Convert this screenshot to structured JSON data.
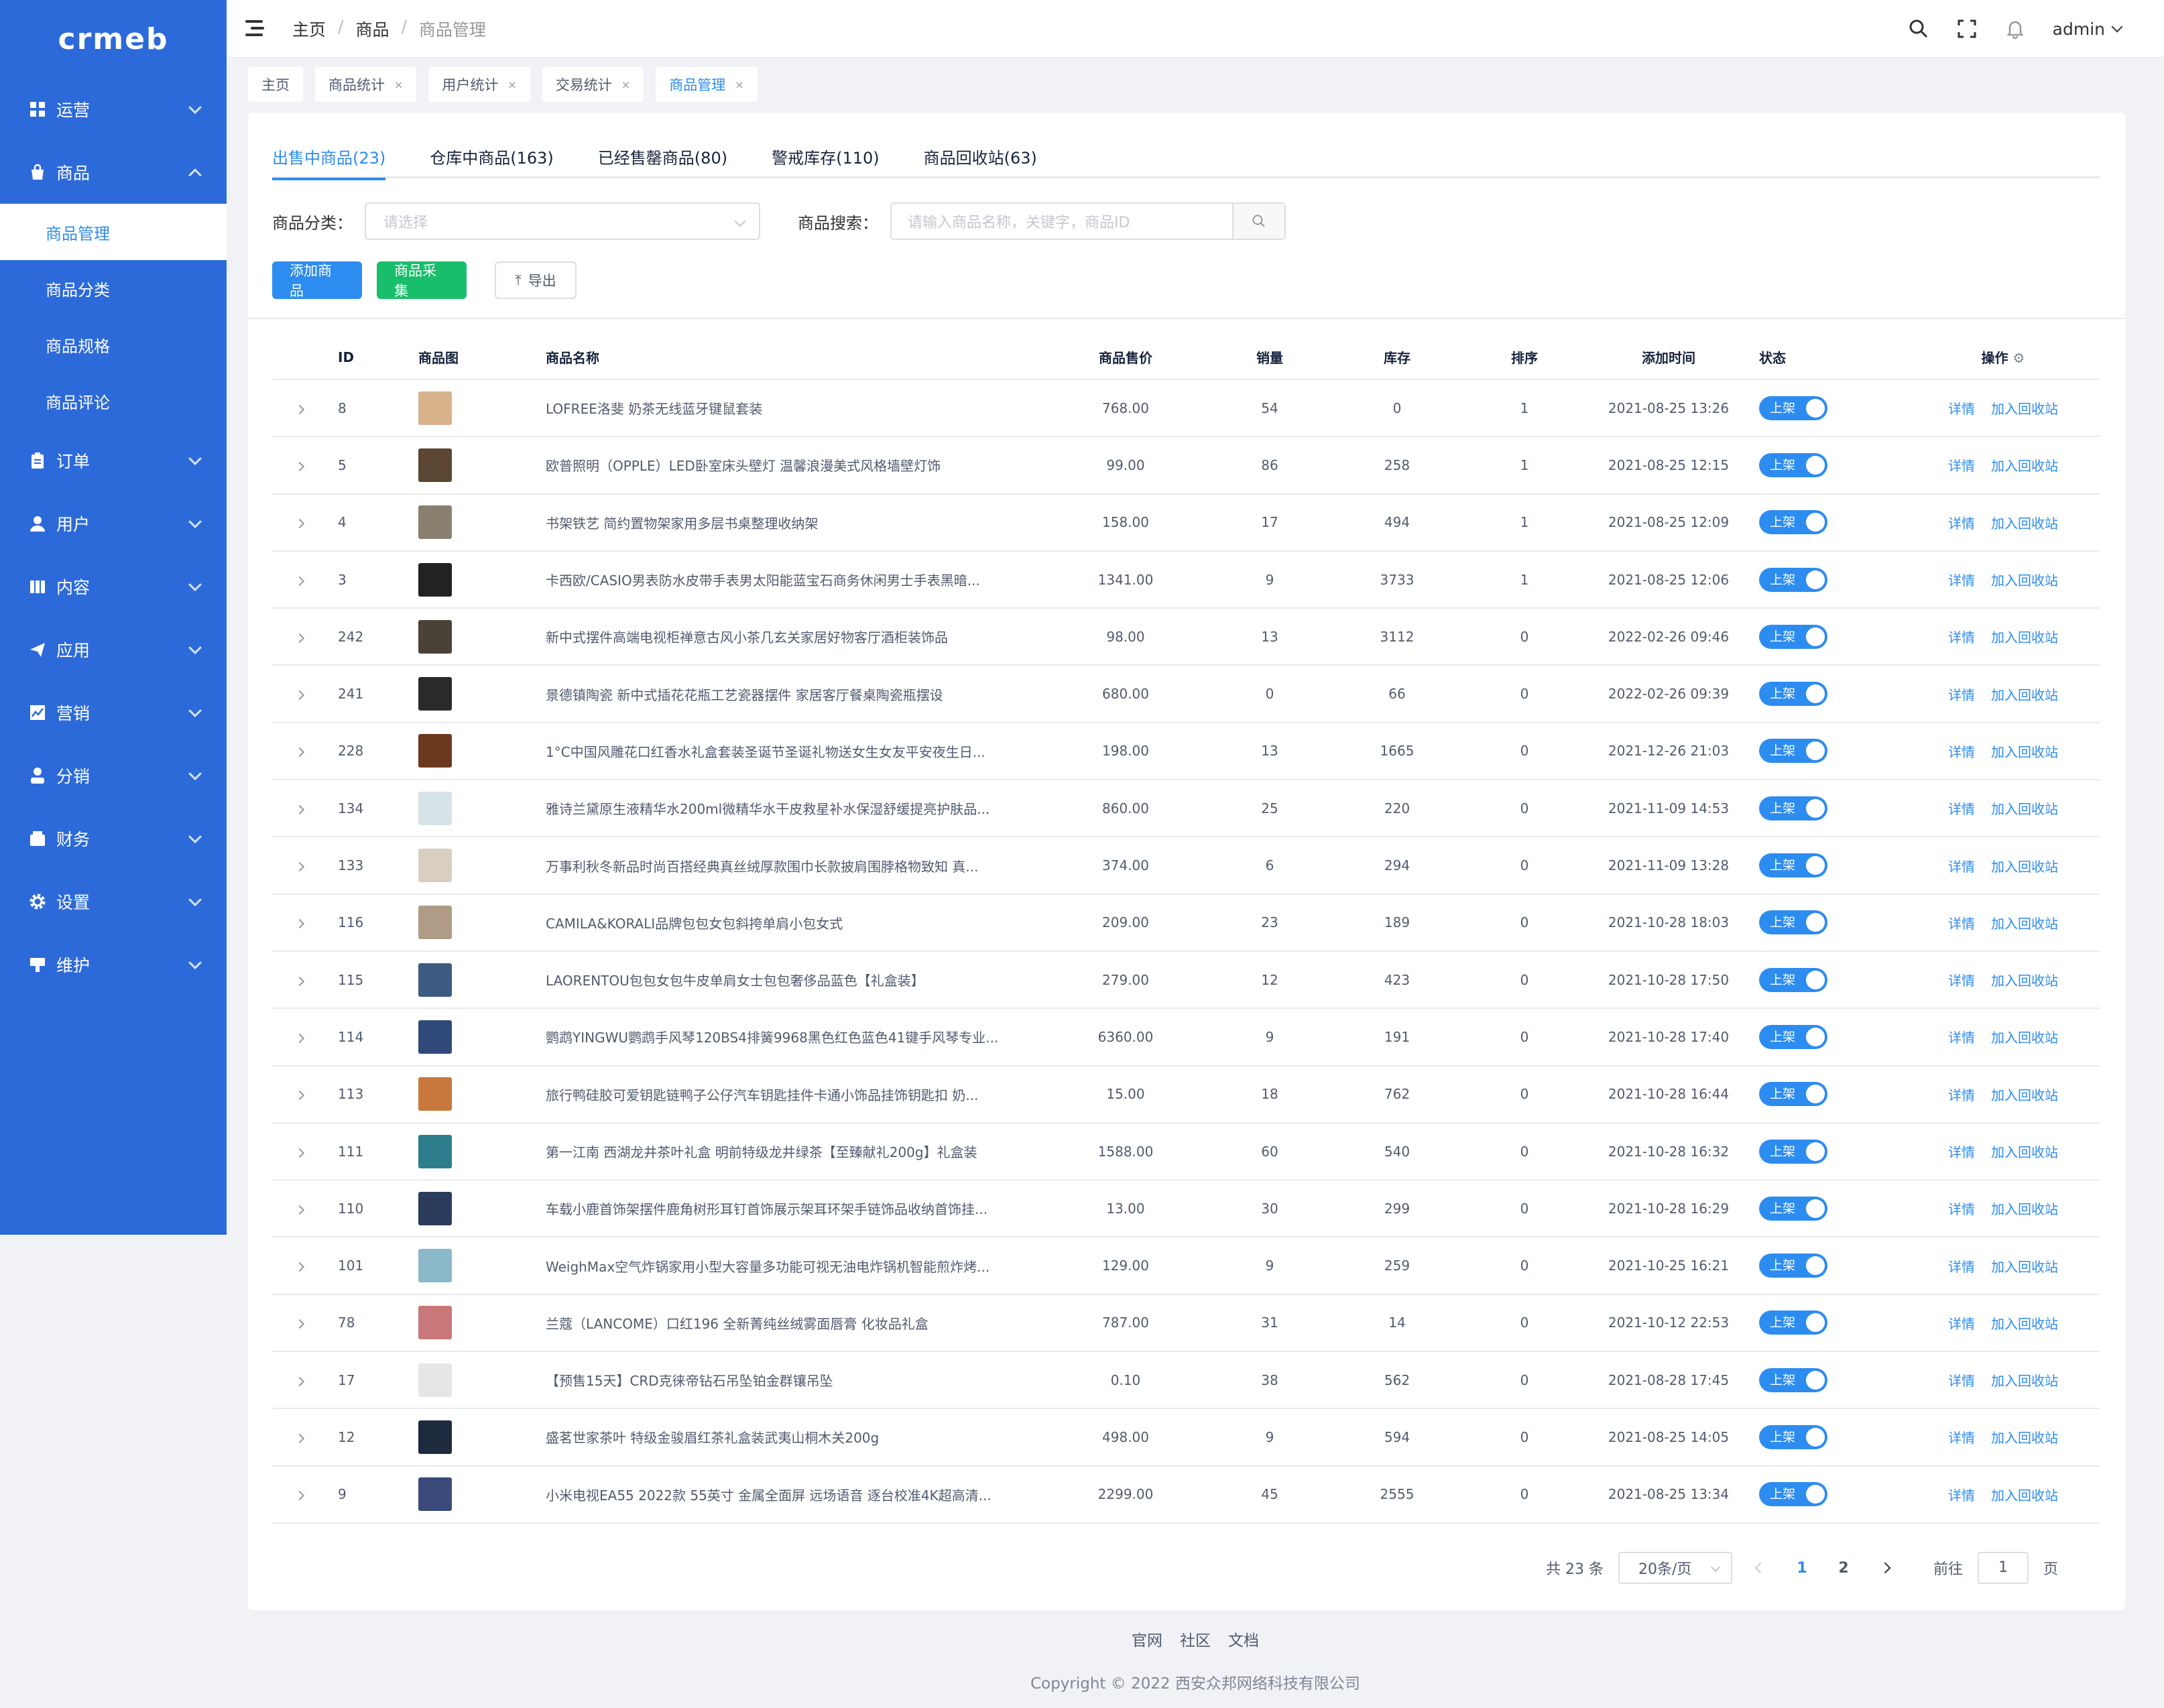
{
  "app": {
    "logo": "crmeb"
  },
  "sidebar": {
    "items": [
      {
        "label": "运营",
        "icon": "dashboard-icon",
        "expanded": false
      },
      {
        "label": "商品",
        "icon": "bag-icon",
        "expanded": true,
        "children": [
          "商品管理",
          "商品分类",
          "商品规格",
          "商品评论"
        ],
        "active_child": "商品管理"
      },
      {
        "label": "订单",
        "icon": "clipboard-icon",
        "expanded": false
      },
      {
        "label": "用户",
        "icon": "user-icon",
        "expanded": false
      },
      {
        "label": "内容",
        "icon": "content-icon",
        "expanded": false
      },
      {
        "label": "应用",
        "icon": "send-icon",
        "expanded": false
      },
      {
        "label": "营销",
        "icon": "chart-icon",
        "expanded": false
      },
      {
        "label": "分销",
        "icon": "person-icon",
        "expanded": false
      },
      {
        "label": "财务",
        "icon": "wallet-icon",
        "expanded": false
      },
      {
        "label": "设置",
        "icon": "gear-icon",
        "expanded": false
      },
      {
        "label": "维护",
        "icon": "tool-icon",
        "expanded": false
      }
    ]
  },
  "header": {
    "breadcrumb": [
      "主页",
      "商品",
      "商品管理"
    ],
    "user": "admin"
  },
  "tags": [
    {
      "label": "主页",
      "closable": false,
      "active": false
    },
    {
      "label": "商品统计",
      "closable": true,
      "active": false
    },
    {
      "label": "用户统计",
      "closable": true,
      "active": false
    },
    {
      "label": "交易统计",
      "closable": true,
      "active": false
    },
    {
      "label": "商品管理",
      "closable": true,
      "active": true
    }
  ],
  "tabs": [
    {
      "label": "出售中商品(23)",
      "active": true
    },
    {
      "label": "仓库中商品(163)",
      "active": false
    },
    {
      "label": "已经售罄商品(80)",
      "active": false
    },
    {
      "label": "警戒库存(110)",
      "active": false
    },
    {
      "label": "商品回收站(63)",
      "active": false
    }
  ],
  "filters": {
    "category_label": "商品分类：",
    "category_placeholder": "请选择",
    "search_label": "商品搜索：",
    "search_placeholder": "请输入商品名称，关键字，商品ID"
  },
  "actions": {
    "add": "添加商品",
    "collect": "商品采集",
    "export": "导出"
  },
  "table": {
    "headers": [
      "ID",
      "商品图",
      "商品名称",
      "商品售价",
      "销量",
      "库存",
      "排序",
      "添加时间",
      "状态",
      "操作"
    ],
    "status_label": "上架",
    "op_detail": "详情",
    "op_recycle": "加入回收站",
    "rows": [
      {
        "id": "8",
        "name": "LOFREE洛斐 奶茶无线蓝牙键鼠套装",
        "price": "768.00",
        "sales": "54",
        "stock": "0",
        "sort": "1",
        "time": "2021-08-25 13:26",
        "thumb": "#d9b38c"
      },
      {
        "id": "5",
        "name": "欧普照明（OPPLE）LED卧室床头壁灯 温馨浪漫美式风格墙壁灯饰",
        "price": "99.00",
        "sales": "86",
        "stock": "258",
        "sort": "1",
        "time": "2021-08-25 12:15",
        "thumb": "#5a4632"
      },
      {
        "id": "4",
        "name": "书架铁艺 简约置物架家用多层书桌整理收纳架",
        "price": "158.00",
        "sales": "17",
        "stock": "494",
        "sort": "1",
        "time": "2021-08-25 12:09",
        "thumb": "#8a8070"
      },
      {
        "id": "3",
        "name": "卡西欧/CASIO男表防水皮带手表男太阳能蓝宝石商务休闲男士手表黑暗...",
        "price": "1341.00",
        "sales": "9",
        "stock": "3733",
        "sort": "1",
        "time": "2021-08-25 12:06",
        "thumb": "#222222"
      },
      {
        "id": "242",
        "name": "新中式摆件高端电视柜禅意古风小茶几玄关家居好物客厅酒柜装饰品",
        "price": "98.00",
        "sales": "13",
        "stock": "3112",
        "sort": "0",
        "time": "2022-02-26 09:46",
        "thumb": "#4a4238"
      },
      {
        "id": "241",
        "name": "景德镇陶瓷 新中式插花花瓶工艺瓷器摆件 家居客厅餐桌陶瓷瓶摆设",
        "price": "680.00",
        "sales": "0",
        "stock": "66",
        "sort": "0",
        "time": "2022-02-26 09:39",
        "thumb": "#2a2a2a"
      },
      {
        "id": "228",
        "name": "1°C中国风雕花口红香水礼盒套装圣诞节圣诞礼物送女生女友平安夜生日...",
        "price": "198.00",
        "sales": "13",
        "stock": "1665",
        "sort": "0",
        "time": "2021-12-26 21:03",
        "thumb": "#6b3a1e"
      },
      {
        "id": "134",
        "name": "雅诗兰黛原生液精华水200ml微精华水干皮救星补水保湿舒缓提亮护肤品...",
        "price": "860.00",
        "sales": "25",
        "stock": "220",
        "sort": "0",
        "time": "2021-11-09 14:53",
        "thumb": "#d6e4e8"
      },
      {
        "id": "133",
        "name": "万事利秋冬新品时尚百搭经典真丝绒厚款围巾长款披肩围脖格物致知 真...",
        "price": "374.00",
        "sales": "6",
        "stock": "294",
        "sort": "0",
        "time": "2021-11-09 13:28",
        "thumb": "#d8cfc0"
      },
      {
        "id": "116",
        "name": "CAMILA&KORALI品牌包包女包斜挎单肩小包女式",
        "price": "209.00",
        "sales": "23",
        "stock": "189",
        "sort": "0",
        "time": "2021-10-28 18:03",
        "thumb": "#b09c86"
      },
      {
        "id": "115",
        "name": "LAORENTOU包包女包牛皮单肩女士包包奢侈品蓝色【礼盒装】",
        "price": "279.00",
        "sales": "12",
        "stock": "423",
        "sort": "0",
        "time": "2021-10-28 17:50",
        "thumb": "#3d5a80"
      },
      {
        "id": "114",
        "name": "鹦鹉YINGWU鹦鹉手风琴120BS4排簧9968黑色红色蓝色41键手风琴专业...",
        "price": "6360.00",
        "sales": "9",
        "stock": "191",
        "sort": "0",
        "time": "2021-10-28 17:40",
        "thumb": "#2f4a7a"
      },
      {
        "id": "113",
        "name": "旅行鸭硅胶可爱钥匙链鸭子公仔汽车钥匙挂件卡通小饰品挂饰钥匙扣 奶...",
        "price": "15.00",
        "sales": "18",
        "stock": "762",
        "sort": "0",
        "time": "2021-10-28 16:44",
        "thumb": "#c8783c"
      },
      {
        "id": "111",
        "name": "第一江南 西湖龙井茶叶礼盒 明前特级龙井绿茶【至臻献礼200g】礼盒装",
        "price": "1588.00",
        "sales": "60",
        "stock": "540",
        "sort": "0",
        "time": "2021-10-28 16:32",
        "thumb": "#2e7d8c"
      },
      {
        "id": "110",
        "name": "车载小鹿首饰架摆件鹿角树形耳钉首饰展示架耳环架手链饰品收纳首饰挂...",
        "price": "13.00",
        "sales": "30",
        "stock": "299",
        "sort": "0",
        "time": "2021-10-28 16:29",
        "thumb": "#2a3b5c"
      },
      {
        "id": "101",
        "name": "WeighMax空气炸锅家用小型大容量多功能可视无油电炸锅机智能煎炸烤...",
        "price": "129.00",
        "sales": "9",
        "stock": "259",
        "sort": "0",
        "time": "2021-10-25 16:21",
        "thumb": "#8ab8c8"
      },
      {
        "id": "78",
        "name": "兰蔻（LANCOME）口红196 全新菁纯丝绒雾面唇膏 化妆品礼盒",
        "price": "787.00",
        "sales": "31",
        "stock": "14",
        "sort": "0",
        "time": "2021-10-12 22:53",
        "thumb": "#c87878"
      },
      {
        "id": "17",
        "name": "【预售15天】CRD克徕帝钻石吊坠铂金群镶吊坠",
        "price": "0.10",
        "sales": "38",
        "stock": "562",
        "sort": "0",
        "time": "2021-08-28 17:45",
        "thumb": "#e6e6e6"
      },
      {
        "id": "12",
        "name": "盛茗世家茶叶 特级金骏眉红茶礼盒装武夷山桐木关200g",
        "price": "498.00",
        "sales": "9",
        "stock": "594",
        "sort": "0",
        "time": "2021-08-25 14:05",
        "thumb": "#1e2a3e"
      },
      {
        "id": "9",
        "name": "小米电视EA55 2022款 55英寸 金属全面屏 远场语音 逐台校准4K超高清...",
        "price": "2299.00",
        "sales": "45",
        "stock": "2555",
        "sort": "0",
        "time": "2021-08-25 13:34",
        "thumb": "#3a4a7a"
      }
    ]
  },
  "pagination": {
    "total": "共 23 条",
    "page_size": "20条/页",
    "pages": [
      "1",
      "2"
    ],
    "current": "1",
    "goto_label": "前往",
    "goto_value": "1",
    "goto_suffix": "页"
  },
  "footer": {
    "links": [
      "官网",
      "社区",
      "文档"
    ],
    "copyright": "Copyright © 2022 西安众邦网络科技有限公司"
  },
  "colors": {
    "sidebar": "#2d6ad9",
    "primary": "#2d8cf0",
    "success": "#19be6b"
  }
}
